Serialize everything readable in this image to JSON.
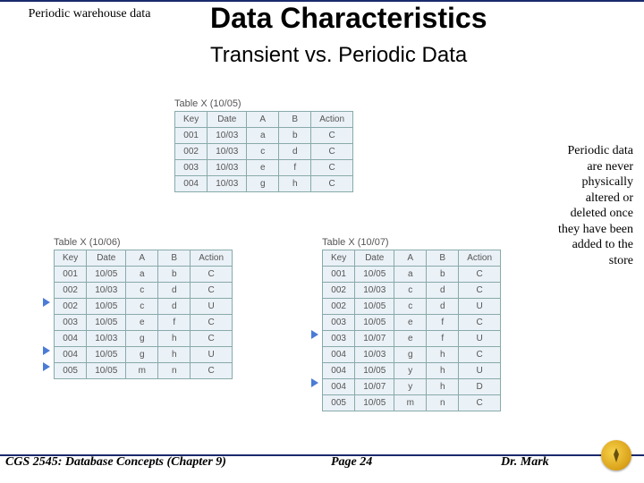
{
  "header": {
    "corner_label": "Periodic warehouse data",
    "title": "Data Characteristics",
    "subtitle": "Transient vs. Periodic Data"
  },
  "callout": "Periodic data are never physically altered or deleted once they have been added to the store",
  "tables": {
    "t1": {
      "caption": "Table X (10/05)",
      "headers": [
        "Key",
        "Date",
        "A",
        "B",
        "Action"
      ],
      "rows": [
        [
          "001",
          "10/03",
          "a",
          "b",
          "C"
        ],
        [
          "002",
          "10/03",
          "c",
          "d",
          "C"
        ],
        [
          "003",
          "10/03",
          "e",
          "f",
          "C"
        ],
        [
          "004",
          "10/03",
          "g",
          "h",
          "C"
        ]
      ],
      "markers": []
    },
    "t2": {
      "caption": "Table X (10/06)",
      "headers": [
        "Key",
        "Date",
        "A",
        "B",
        "Action"
      ],
      "rows": [
        [
          "001",
          "10/05",
          "a",
          "b",
          "C"
        ],
        [
          "002",
          "10/03",
          "c",
          "d",
          "C"
        ],
        [
          "002",
          "10/05",
          "c",
          "d",
          "U"
        ],
        [
          "003",
          "10/05",
          "e",
          "f",
          "C"
        ],
        [
          "004",
          "10/03",
          "g",
          "h",
          "C"
        ],
        [
          "004",
          "10/05",
          "g",
          "h",
          "U"
        ],
        [
          "005",
          "10/05",
          "m",
          "n",
          "C"
        ]
      ],
      "markers": [
        2,
        5,
        6
      ]
    },
    "t3": {
      "caption": "Table X (10/07)",
      "headers": [
        "Key",
        "Date",
        "A",
        "B",
        "Action"
      ],
      "rows": [
        [
          "001",
          "10/05",
          "a",
          "b",
          "C"
        ],
        [
          "002",
          "10/03",
          "c",
          "d",
          "C"
        ],
        [
          "002",
          "10/05",
          "c",
          "d",
          "U"
        ],
        [
          "003",
          "10/05",
          "e",
          "f",
          "C"
        ],
        [
          "003",
          "10/07",
          "e",
          "f",
          "U"
        ],
        [
          "004",
          "10/03",
          "g",
          "h",
          "C"
        ],
        [
          "004",
          "10/05",
          "y",
          "h",
          "U"
        ],
        [
          "004",
          "10/07",
          "y",
          "h",
          "D"
        ],
        [
          "005",
          "10/05",
          "m",
          "n",
          "C"
        ]
      ],
      "markers": [
        4,
        7
      ]
    }
  },
  "footer": {
    "left": "CGS 2545: Database Concepts  (Chapter 9)",
    "center": "Page 24",
    "right": "Dr. Mark"
  }
}
